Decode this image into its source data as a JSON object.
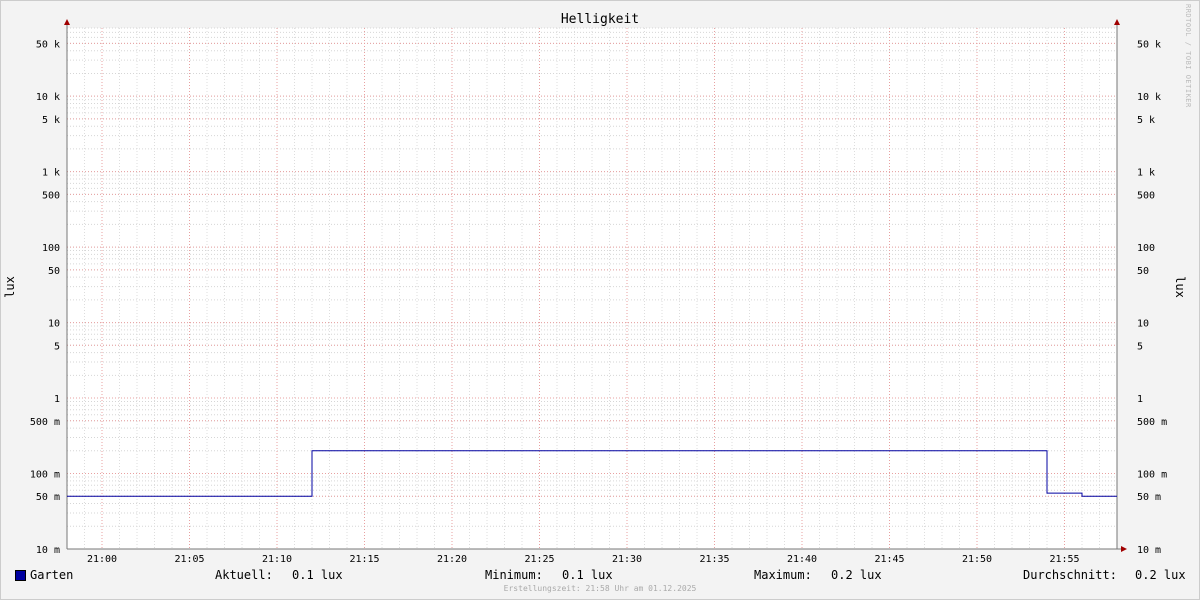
{
  "chart_data": {
    "type": "line",
    "title": "Helligkeit",
    "ylabel": "lux",
    "yscale": "log",
    "ylim": [
      0.01,
      80000
    ],
    "xlim": [
      "20:58",
      "21:58"
    ],
    "x_ticks": [
      "21:00",
      "21:05",
      "21:10",
      "21:15",
      "21:20",
      "21:25",
      "21:30",
      "21:35",
      "21:40",
      "21:45",
      "21:50",
      "21:55"
    ],
    "y_ticks": [
      {
        "value": 50000,
        "label": "50 k"
      },
      {
        "value": 10000,
        "label": "10 k"
      },
      {
        "value": 5000,
        "label": "5 k"
      },
      {
        "value": 1000,
        "label": "1 k"
      },
      {
        "value": 500,
        "label": "500"
      },
      {
        "value": 100,
        "label": "100"
      },
      {
        "value": 50,
        "label": "50"
      },
      {
        "value": 10,
        "label": "10"
      },
      {
        "value": 5,
        "label": "5"
      },
      {
        "value": 1,
        "label": "1"
      },
      {
        "value": 0.5,
        "label": "500 m"
      },
      {
        "value": 0.1,
        "label": "100 m"
      },
      {
        "value": 0.05,
        "label": "50 m"
      },
      {
        "value": 0.01,
        "label": "10 m"
      }
    ],
    "grid": true,
    "series": [
      {
        "name": "Garten",
        "color": "#0000a0",
        "step": true,
        "points": [
          {
            "x": "20:58",
            "y": 0.05
          },
          {
            "x": "21:12",
            "y": 0.05
          },
          {
            "x": "21:12",
            "y": 0.2
          },
          {
            "x": "21:54",
            "y": 0.2
          },
          {
            "x": "21:54",
            "y": 0.055
          },
          {
            "x": "21:56",
            "y": 0.055
          },
          {
            "x": "21:56",
            "y": 0.05
          },
          {
            "x": "21:58",
            "y": 0.05
          }
        ]
      }
    ]
  },
  "legend": {
    "series_name": "Garten",
    "aktuell_label": "Aktuell:",
    "aktuell_value": "0.1 lux",
    "minimum_label": "Minimum:",
    "minimum_value": "0.1 lux",
    "maximum_label": "Maximum:",
    "maximum_value": "0.2 lux",
    "durchschnitt_label": "Durchschnitt:",
    "durchschnitt_value": "0.2 lux"
  },
  "footer": "Erstellungszeit: 21:58 Uhr am 01.12.2025",
  "watermark": "RRDTOOL / TOBI OETIKER"
}
